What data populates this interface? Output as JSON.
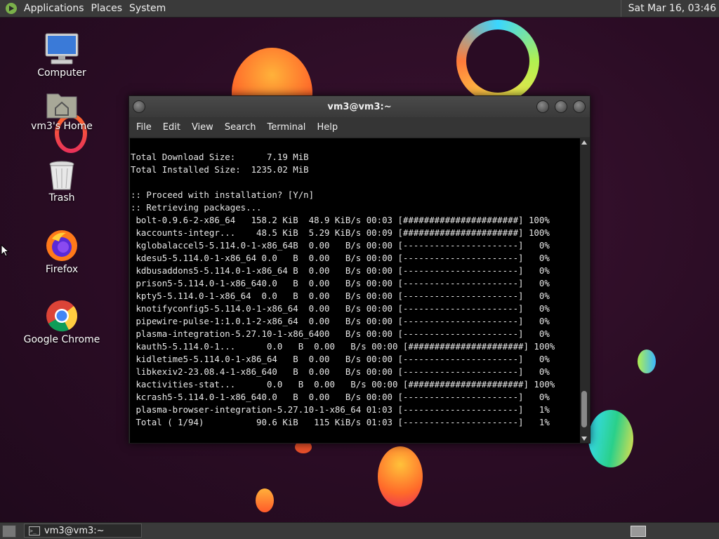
{
  "top_panel": {
    "menus": [
      "Applications",
      "Places",
      "System"
    ],
    "clock": "Sat Mar 16, 03:46"
  },
  "desktop": {
    "icons": [
      {
        "label": "Computer",
        "icon": "computer-icon"
      },
      {
        "label": "vm3's Home",
        "icon": "home-folder-icon"
      },
      {
        "label": "Trash",
        "icon": "trash-icon"
      },
      {
        "label": "Firefox",
        "icon": "firefox-icon"
      },
      {
        "label": "Google Chrome",
        "icon": "chrome-icon"
      }
    ]
  },
  "window": {
    "title": "vm3@vm3:~",
    "menus": [
      "File",
      "Edit",
      "View",
      "Search",
      "Terminal",
      "Help"
    ],
    "terminal_lines": [
      "Total Download Size:      7.19 MiB",
      "Total Installed Size:  1235.02 MiB",
      "",
      ":: Proceed with installation? [Y/n]",
      ":: Retrieving packages...",
      " bolt-0.9.6-2-x86_64   158.2 KiB  48.9 KiB/s 00:03 [######################] 100%",
      " kaccounts-integr...    48.5 KiB  5.29 KiB/s 00:09 [######################] 100%",
      " kglobalaccel5-5.114.0-1-x86_64B  0.00   B/s 00:00 [----------------------]   0%",
      " kdesu5-5.114.0-1-x86_64 0.0   B  0.00   B/s 00:00 [----------------------]   0%",
      " kdbusaddons5-5.114.0-1-x86_64 B  0.00   B/s 00:00 [----------------------]   0%",
      " prison5-5.114.0-1-x86_640.0   B  0.00   B/s 00:00 [----------------------]   0%",
      " kpty5-5.114.0-1-x86_64  0.0   B  0.00   B/s 00:00 [----------------------]   0%",
      " knotifyconfig5-5.114.0-1-x86_64  0.00   B/s 00:00 [----------------------]   0%",
      " pipewire-pulse-1:1.0.1-2-x86_64  0.00   B/s 00:00 [----------------------]   0%",
      " plasma-integration-5.27.10-1-x86_6400   B/s 00:00 [----------------------]   0%",
      " kauth5-5.114.0-1...      0.0   B  0.00   B/s 00:00 [######################] 100%",
      " kidletime5-5.114.0-1-x86_64   B  0.00   B/s 00:00 [----------------------]   0%",
      " libkexiv2-23.08.4-1-x86_640   B  0.00   B/s 00:00 [----------------------]   0%",
      " kactivities-stat...      0.0   B  0.00   B/s 00:00 [######################] 100%",
      " kcrash5-5.114.0-1-x86_640.0   B  0.00   B/s 00:00 [----------------------]   0%",
      " plasma-browser-integration-5.27.10-1-x86_64 01:03 [----------------------]   1%",
      " Total ( 1/94)          90.6 KiB   115 KiB/s 01:03 [----------------------]   1%"
    ]
  },
  "taskbar": {
    "task_label": "vm3@vm3:~"
  }
}
